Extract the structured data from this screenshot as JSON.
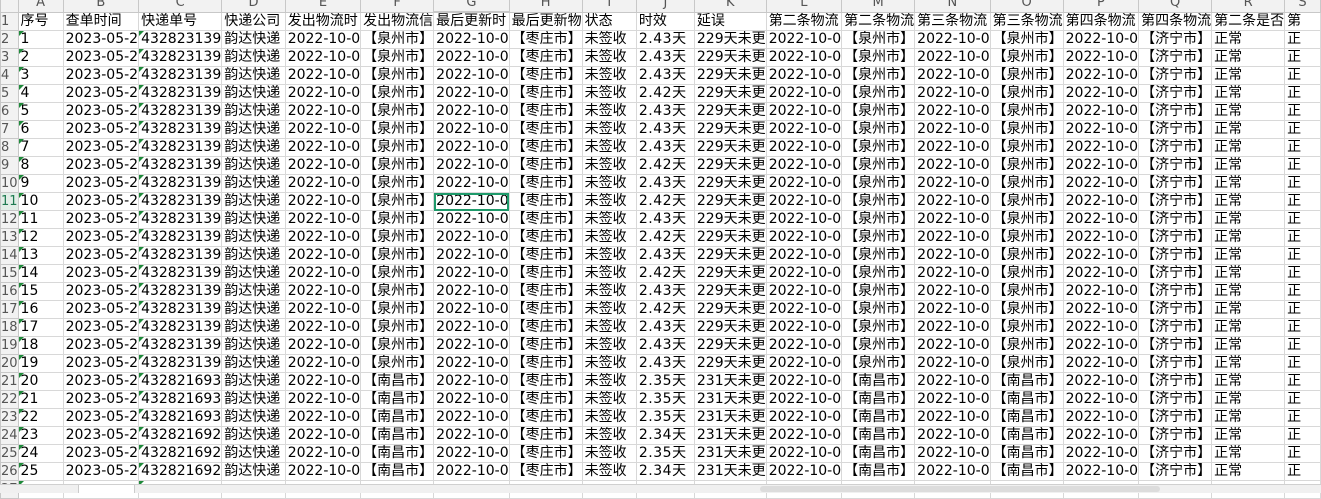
{
  "sheet": {
    "columns": [
      "A",
      "B",
      "C",
      "D",
      "E",
      "F",
      "G",
      "H",
      "I",
      "J",
      "K",
      "L",
      "M",
      "N",
      "O",
      "P",
      "Q",
      "R",
      "S"
    ],
    "selected_cell": "G11",
    "header_row": [
      "序号",
      "查单时间",
      "快递单号",
      "快递公司",
      "发出物流时",
      "发出物流信",
      "最后更新时",
      "最后更新物",
      "状态",
      "时效",
      "延误",
      "第二条物流",
      "第二条物流",
      "第三条物流",
      "第三条物流",
      "第四条物流",
      "第四条物流",
      "第二条是否",
      "第"
    ],
    "rows": [
      [
        "1",
        "2023-05-2",
        "432823139",
        "韵达快递",
        "2022-10-0",
        "【泉州市】",
        "2022-10-0",
        "【枣庄市】",
        "未签收",
        "2.43天",
        "229天未更",
        "2022-10-0",
        "【泉州市】",
        "2022-10-0",
        "【泉州市】",
        "2022-10-0",
        "【济宁市】",
        "正常",
        "正"
      ],
      [
        "2",
        "2023-05-2",
        "432823139",
        "韵达快递",
        "2022-10-0",
        "【泉州市】",
        "2022-10-0",
        "【枣庄市】",
        "未签收",
        "2.43天",
        "229天未更",
        "2022-10-0",
        "【泉州市】",
        "2022-10-0",
        "【泉州市】",
        "2022-10-0",
        "【济宁市】",
        "正常",
        "正"
      ],
      [
        "3",
        "2023-05-2",
        "432823139",
        "韵达快递",
        "2022-10-0",
        "【泉州市】",
        "2022-10-0",
        "【枣庄市】",
        "未签收",
        "2.43天",
        "229天未更",
        "2022-10-0",
        "【泉州市】",
        "2022-10-0",
        "【泉州市】",
        "2022-10-0",
        "【济宁市】",
        "正常",
        "正"
      ],
      [
        "4",
        "2023-05-2",
        "432823139",
        "韵达快递",
        "2022-10-0",
        "【泉州市】",
        "2022-10-0",
        "【枣庄市】",
        "未签收",
        "2.42天",
        "229天未更",
        "2022-10-0",
        "【泉州市】",
        "2022-10-0",
        "【泉州市】",
        "2022-10-0",
        "【济宁市】",
        "正常",
        "正"
      ],
      [
        "5",
        "2023-05-2",
        "432823139",
        "韵达快递",
        "2022-10-0",
        "【泉州市】",
        "2022-10-0",
        "【枣庄市】",
        "未签收",
        "2.43天",
        "229天未更",
        "2022-10-0",
        "【泉州市】",
        "2022-10-0",
        "【泉州市】",
        "2022-10-0",
        "【济宁市】",
        "正常",
        "正"
      ],
      [
        "6",
        "2023-05-2",
        "432823139",
        "韵达快递",
        "2022-10-0",
        "【泉州市】",
        "2022-10-0",
        "【枣庄市】",
        "未签收",
        "2.43天",
        "229天未更",
        "2022-10-0",
        "【泉州市】",
        "2022-10-0",
        "【泉州市】",
        "2022-10-0",
        "【济宁市】",
        "正常",
        "正"
      ],
      [
        "7",
        "2023-05-2",
        "432823139",
        "韵达快递",
        "2022-10-0",
        "【泉州市】",
        "2022-10-0",
        "【枣庄市】",
        "未签收",
        "2.43天",
        "229天未更",
        "2022-10-0",
        "【泉州市】",
        "2022-10-0",
        "【泉州市】",
        "2022-10-0",
        "【济宁市】",
        "正常",
        "正"
      ],
      [
        "8",
        "2023-05-2",
        "432823139",
        "韵达快递",
        "2022-10-0",
        "【泉州市】",
        "2022-10-0",
        "【枣庄市】",
        "未签收",
        "2.42天",
        "229天未更",
        "2022-10-0",
        "【泉州市】",
        "2022-10-0",
        "【泉州市】",
        "2022-10-0",
        "【济宁市】",
        "正常",
        "正"
      ],
      [
        "9",
        "2023-05-2",
        "432823139",
        "韵达快递",
        "2022-10-0",
        "【泉州市】",
        "2022-10-0",
        "【枣庄市】",
        "未签收",
        "2.43天",
        "229天未更",
        "2022-10-0",
        "【泉州市】",
        "2022-10-0",
        "【泉州市】",
        "2022-10-0",
        "【济宁市】",
        "正常",
        "正"
      ],
      [
        "10",
        "2023-05-2",
        "432823139",
        "韵达快递",
        "2022-10-0",
        "【泉州市】",
        "2022-10-0",
        "【枣庄市】",
        "未签收",
        "2.42天",
        "229天未更",
        "2022-10-0",
        "【泉州市】",
        "2022-10-0",
        "【泉州市】",
        "2022-10-0",
        "【济宁市】",
        "正常",
        "正"
      ],
      [
        "11",
        "2023-05-2",
        "432823139",
        "韵达快递",
        "2022-10-0",
        "【泉州市】",
        "2022-10-0",
        "【枣庄市】",
        "未签收",
        "2.43天",
        "229天未更",
        "2022-10-0",
        "【泉州市】",
        "2022-10-0",
        "【泉州市】",
        "2022-10-0",
        "【济宁市】",
        "正常",
        "正"
      ],
      [
        "12",
        "2023-05-2",
        "432823139",
        "韵达快递",
        "2022-10-0",
        "【泉州市】",
        "2022-10-0",
        "【枣庄市】",
        "未签收",
        "2.42天",
        "229天未更",
        "2022-10-0",
        "【泉州市】",
        "2022-10-0",
        "【泉州市】",
        "2022-10-0",
        "【济宁市】",
        "正常",
        "正"
      ],
      [
        "13",
        "2023-05-2",
        "432823139",
        "韵达快递",
        "2022-10-0",
        "【泉州市】",
        "2022-10-0",
        "【枣庄市】",
        "未签收",
        "2.43天",
        "229天未更",
        "2022-10-0",
        "【泉州市】",
        "2022-10-0",
        "【泉州市】",
        "2022-10-0",
        "【济宁市】",
        "正常",
        "正"
      ],
      [
        "14",
        "2023-05-2",
        "432823139",
        "韵达快递",
        "2022-10-0",
        "【泉州市】",
        "2022-10-0",
        "【枣庄市】",
        "未签收",
        "2.42天",
        "229天未更",
        "2022-10-0",
        "【泉州市】",
        "2022-10-0",
        "【泉州市】",
        "2022-10-0",
        "【济宁市】",
        "正常",
        "正"
      ],
      [
        "15",
        "2023-05-2",
        "432823139",
        "韵达快递",
        "2022-10-0",
        "【泉州市】",
        "2022-10-0",
        "【枣庄市】",
        "未签收",
        "2.43天",
        "229天未更",
        "2022-10-0",
        "【泉州市】",
        "2022-10-0",
        "【泉州市】",
        "2022-10-0",
        "【济宁市】",
        "正常",
        "正"
      ],
      [
        "16",
        "2023-05-2",
        "432823139",
        "韵达快递",
        "2022-10-0",
        "【泉州市】",
        "2022-10-0",
        "【枣庄市】",
        "未签收",
        "2.42天",
        "229天未更",
        "2022-10-0",
        "【泉州市】",
        "2022-10-0",
        "【泉州市】",
        "2022-10-0",
        "【济宁市】",
        "正常",
        "正"
      ],
      [
        "17",
        "2023-05-2",
        "432823139",
        "韵达快递",
        "2022-10-0",
        "【泉州市】",
        "2022-10-0",
        "【枣庄市】",
        "未签收",
        "2.43天",
        "229天未更",
        "2022-10-0",
        "【泉州市】",
        "2022-10-0",
        "【泉州市】",
        "2022-10-0",
        "【济宁市】",
        "正常",
        "正"
      ],
      [
        "18",
        "2023-05-2",
        "432823139",
        "韵达快递",
        "2022-10-0",
        "【泉州市】",
        "2022-10-0",
        "【枣庄市】",
        "未签收",
        "2.43天",
        "229天未更",
        "2022-10-0",
        "【泉州市】",
        "2022-10-0",
        "【泉州市】",
        "2022-10-0",
        "【济宁市】",
        "正常",
        "正"
      ],
      [
        "19",
        "2023-05-2",
        "432823139",
        "韵达快递",
        "2022-10-0",
        "【泉州市】",
        "2022-10-0",
        "【枣庄市】",
        "未签收",
        "2.43天",
        "229天未更",
        "2022-10-0",
        "【泉州市】",
        "2022-10-0",
        "【泉州市】",
        "2022-10-0",
        "【济宁市】",
        "正常",
        "正"
      ],
      [
        "20",
        "2023-05-2",
        "432821693",
        "韵达快递",
        "2022-10-0",
        "【南昌市】",
        "2022-10-0",
        "【枣庄市】",
        "未签收",
        "2.35天",
        "231天未更",
        "2022-10-0",
        "【南昌市】",
        "2022-10-0",
        "【南昌市】",
        "2022-10-0",
        "【济宁市】",
        "正常",
        "正"
      ],
      [
        "21",
        "2023-05-2",
        "432821693",
        "韵达快递",
        "2022-10-0",
        "【南昌市】",
        "2022-10-0",
        "【枣庄市】",
        "未签收",
        "2.35天",
        "231天未更",
        "2022-10-0",
        "【南昌市】",
        "2022-10-0",
        "【南昌市】",
        "2022-10-0",
        "【济宁市】",
        "正常",
        "正"
      ],
      [
        "22",
        "2023-05-2",
        "432821693",
        "韵达快递",
        "2022-10-0",
        "【南昌市】",
        "2022-10-0",
        "【枣庄市】",
        "未签收",
        "2.35天",
        "231天未更",
        "2022-10-0",
        "【南昌市】",
        "2022-10-0",
        "【南昌市】",
        "2022-10-0",
        "【济宁市】",
        "正常",
        "正"
      ],
      [
        "23",
        "2023-05-2",
        "432821692",
        "韵达快递",
        "2022-10-0",
        "【南昌市】",
        "2022-10-0",
        "【枣庄市】",
        "未签收",
        "2.34天",
        "231天未更",
        "2022-10-0",
        "【南昌市】",
        "2022-10-0",
        "【南昌市】",
        "2022-10-0",
        "【济宁市】",
        "正常",
        "正"
      ],
      [
        "24",
        "2023-05-2",
        "432821692",
        "韵达快递",
        "2022-10-0",
        "【南昌市】",
        "2022-10-0",
        "【枣庄市】",
        "未签收",
        "2.35天",
        "231天未更",
        "2022-10-0",
        "【南昌市】",
        "2022-10-0",
        "【南昌市】",
        "2022-10-0",
        "【济宁市】",
        "正常",
        "正"
      ],
      [
        "25",
        "2023-05-2",
        "432821692",
        "韵达快递",
        "2022-10-0",
        "【南昌市】",
        "2022-10-0",
        "【枣庄市】",
        "未签收",
        "2.34天",
        "231天未更",
        "2022-10-0",
        "【南昌市】",
        "2022-10-0",
        "【南昌市】",
        "2022-10-0",
        "【济宁市】",
        "正常",
        "正"
      ]
    ]
  }
}
